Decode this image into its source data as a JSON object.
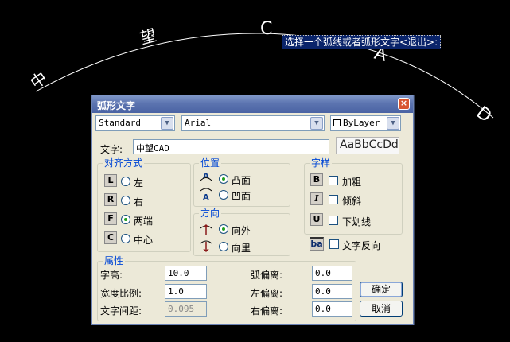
{
  "canvas": {
    "arc_chars": [
      "中",
      "望",
      "C",
      "A",
      "D"
    ],
    "prompt": "选择一个弧线或者弧形文字<退出>:"
  },
  "dialog": {
    "title": "弧形文字",
    "close_label": "×",
    "style_select": "Standard",
    "font_select": "Arial",
    "layer_select": "ByLayer",
    "text_label": "文字:",
    "text_value": "中望CAD",
    "preview": "AaBbCcDd",
    "align": {
      "title": "对齐方式",
      "options": [
        {
          "icon": "L",
          "label": "左",
          "checked": false
        },
        {
          "icon": "R",
          "label": "右",
          "checked": false
        },
        {
          "icon": "F",
          "label": "两端",
          "checked": true
        },
        {
          "icon": "C",
          "label": "中心",
          "checked": false
        }
      ]
    },
    "position": {
      "title": "位置",
      "options": [
        {
          "label": "凸面",
          "checked": true
        },
        {
          "label": "凹面",
          "checked": false
        }
      ]
    },
    "direction": {
      "title": "方向",
      "options": [
        {
          "label": "向外",
          "checked": true
        },
        {
          "label": "向里",
          "checked": false
        }
      ]
    },
    "font_style": {
      "title": "字样",
      "options": [
        {
          "icon": "B",
          "label": "加粗",
          "checked": false
        },
        {
          "icon": "I",
          "label": "倾斜",
          "checked": false
        },
        {
          "icon": "U",
          "label": "下划线",
          "checked": false
        }
      ],
      "reverse_icon": "ba",
      "reverse_label": "文字反向"
    },
    "props": {
      "title": "属性",
      "height_label": "字高:",
      "height_value": "10.0",
      "width_label": "宽度比例:",
      "width_value": "1.0",
      "spacing_label": "文字间距:",
      "spacing_value": "0.095",
      "arc_offset_label": "弧偏离:",
      "arc_offset_value": "0.0",
      "left_offset_label": "左偏离:",
      "left_offset_value": "0.0",
      "right_offset_label": "右偏离:",
      "right_offset_value": "0.0"
    },
    "ok_label": "确定",
    "cancel_label": "取消"
  }
}
